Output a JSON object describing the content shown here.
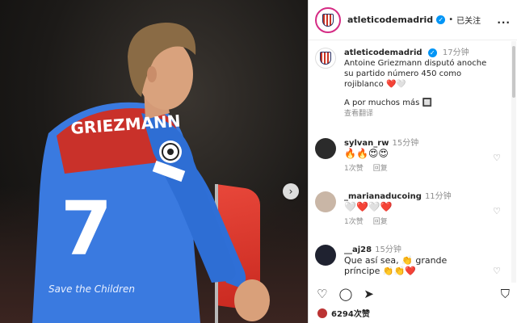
{
  "post": {
    "jersey_text": "GRIEZMANN",
    "jersey_number": "7",
    "sponsor_text": "Save the Children"
  },
  "header": {
    "username": "atleticodemadrid",
    "separator": "•",
    "follow_label": "已关注",
    "more_label": "..."
  },
  "caption": {
    "username": "atleticodemadrid",
    "time": "17分钟",
    "text": "Antoine Griezmann disputó anoche su partido número 450 como rojiblanco",
    "hearts": "❤️🤍",
    "text2": "A por muchos más 🔲",
    "translate_label": "查看翻译"
  },
  "comments": [
    {
      "username": "sylvan_rw",
      "time": "15分钟",
      "text": "🔥🔥😍😍",
      "likes_label": "1次赞",
      "reply_label": "回复"
    },
    {
      "username": "_marianaducoing",
      "time": "11分钟",
      "text": "🤍❤️🤍❤️",
      "likes_label": "1次赞",
      "reply_label": "回复"
    },
    {
      "username": "__aj28",
      "time": "15分钟",
      "text": "Que así sea, 👏 grande príncipe 👏👏❤️",
      "likes_label": "",
      "reply_label": ""
    }
  ],
  "actions": {
    "like_icon": "heart-outline-icon",
    "comment_icon": "comment-icon",
    "share_icon": "send-icon",
    "save_icon": "bookmark-icon"
  },
  "likes_count": "6294次赞",
  "colors": {
    "verified": "#0095f6",
    "heart": "#ed4956",
    "atleti_red": "#cb3524",
    "atleti_blue": "#272e61"
  }
}
